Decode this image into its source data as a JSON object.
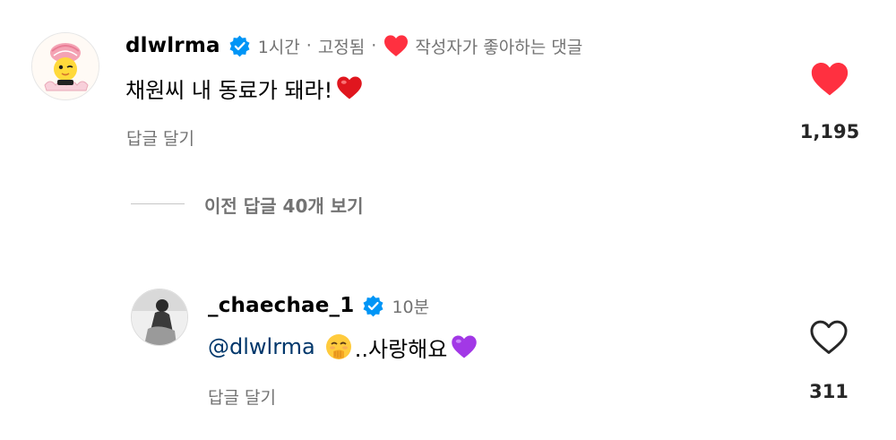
{
  "comments": [
    {
      "username": "dlwlrma",
      "time": "1시간",
      "pinned": "고정됨",
      "liked_by_author": "작성자가 좋아하는 댓글",
      "text": "채원씨 내 동료가 돼라!",
      "reply_label": "답글 달기",
      "like_count": "1,195",
      "liked": true
    },
    {
      "username": "_chaechae_1",
      "time": "10분",
      "mention": "@dlwlrma",
      "text": "..사랑해요",
      "reply_label": "답글 달기",
      "like_count": "311",
      "liked": false
    }
  ],
  "view_previous": "이전 답글 40개 보기",
  "colors": {
    "like_red": "#ff3040",
    "verified_blue": "#0095f6",
    "mention_blue": "#00376b",
    "secondary_text": "#737373"
  }
}
